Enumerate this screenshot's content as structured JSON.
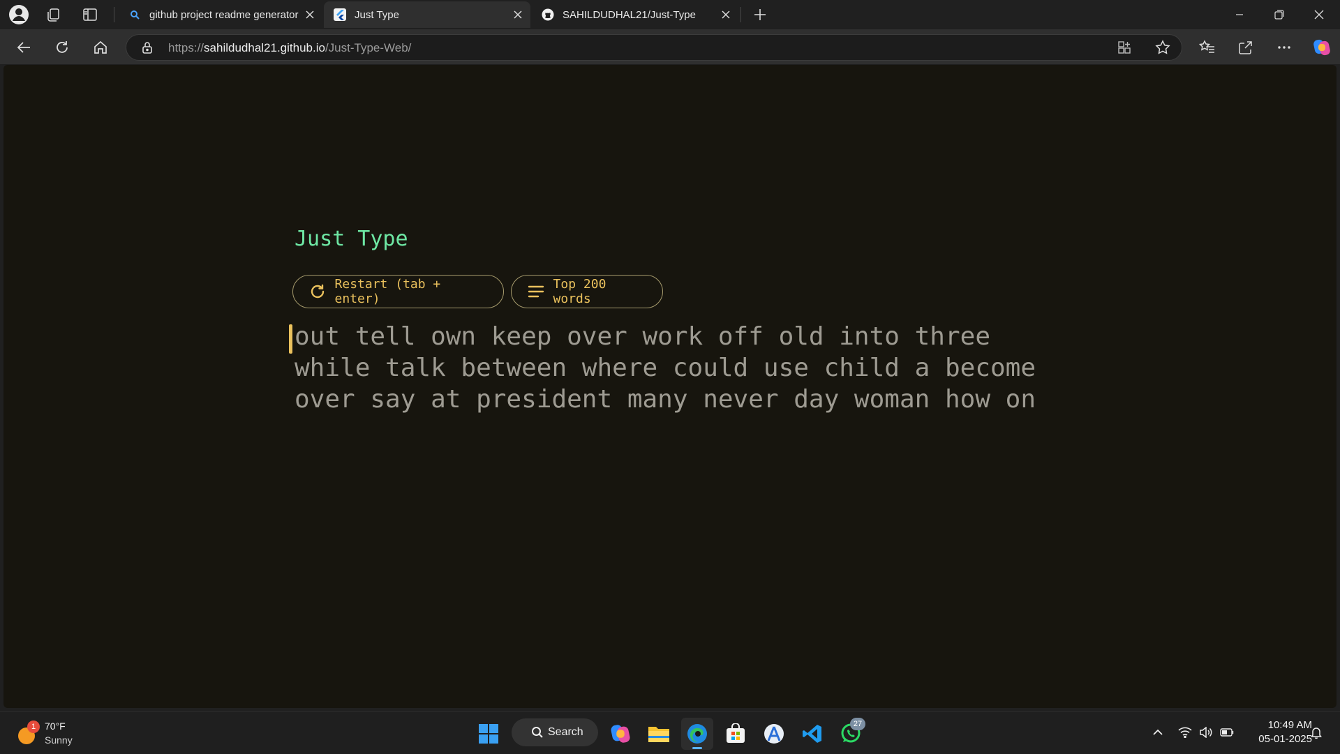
{
  "browser": {
    "tabs": [
      {
        "label": "github project readme generator",
        "icon": "search-icon",
        "active": false
      },
      {
        "label": "Just Type",
        "icon": "flutter-icon",
        "active": true
      },
      {
        "label": "SAHILDUDHAL21/Just-Type",
        "icon": "github-icon",
        "active": false
      }
    ],
    "url_prefix": "https://",
    "url_domain": "sahildudhal21.github.io",
    "url_path": "/Just-Type-Web/"
  },
  "app": {
    "title": "Just Type",
    "restart_label": "Restart (tab + enter)",
    "wordset_label": "Top 200 words",
    "text_lines": [
      "out tell own keep over work off old into three",
      "while talk between where could use child a become",
      "over say at president many never day woman how on"
    ],
    "colors": {
      "title": "#6ee7a4",
      "accent": "#eac15d",
      "text": "#9e9b92",
      "background": "#17150e"
    }
  },
  "taskbar": {
    "weather_badge": "1",
    "temperature": "70°F",
    "condition": "Sunny",
    "search_label": "Search",
    "whatsapp_badge": "27",
    "time": "10:49 AM",
    "date": "05-01-2025"
  }
}
